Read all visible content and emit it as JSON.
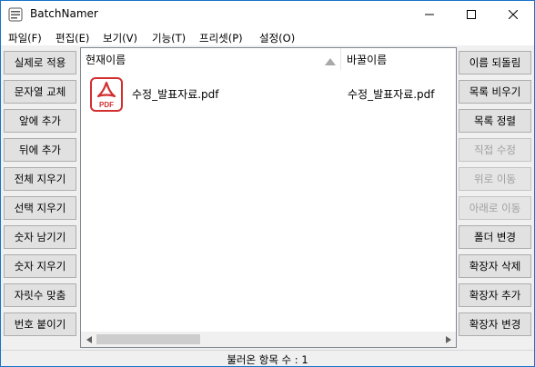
{
  "window": {
    "title": "BatchNamer"
  },
  "menu": [
    {
      "label": "파일(F)"
    },
    {
      "label": "편집(E)"
    },
    {
      "label": "보기(V)"
    },
    {
      "label": "기능(T)"
    },
    {
      "label": "프리셋(P)"
    },
    {
      "label": "설정(O)"
    }
  ],
  "left_buttons": [
    {
      "label": "실제로 적용"
    },
    {
      "label": "문자열 교체"
    },
    {
      "label": "앞에 추가"
    },
    {
      "label": "뒤에 추가"
    },
    {
      "label": "전체 지우기"
    },
    {
      "label": "선택 지우기"
    },
    {
      "label": "숫자 남기기"
    },
    {
      "label": "숫자 지우기"
    },
    {
      "label": "자릿수 맞춤"
    },
    {
      "label": "번호 붙이기"
    }
  ],
  "right_buttons": [
    {
      "label": "이름 되돌림",
      "enabled": true
    },
    {
      "label": "목록 비우기",
      "enabled": true
    },
    {
      "label": "목록 정렬",
      "enabled": true
    },
    {
      "label": "직접 수정",
      "enabled": false
    },
    {
      "label": "위로 이동",
      "enabled": false
    },
    {
      "label": "아래로 이동",
      "enabled": false
    },
    {
      "label": "폴더 변경",
      "enabled": true
    },
    {
      "label": "확장자 삭제",
      "enabled": true
    },
    {
      "label": "확장자 추가",
      "enabled": true
    },
    {
      "label": "확장자 변경",
      "enabled": true
    }
  ],
  "list": {
    "columns": {
      "current": "현재이름",
      "new": "바꿀이름"
    },
    "rows": [
      {
        "icon": "pdf-file-icon",
        "icon_text": "PDF",
        "current_name": "수정_발표자료.pdf",
        "new_name": "수정_발표자료.pdf"
      }
    ]
  },
  "status": {
    "text": "불러온 항목 수 : 1"
  },
  "colors": {
    "pdf_red": "#d32f2f",
    "window_border": "#1a73c9"
  }
}
